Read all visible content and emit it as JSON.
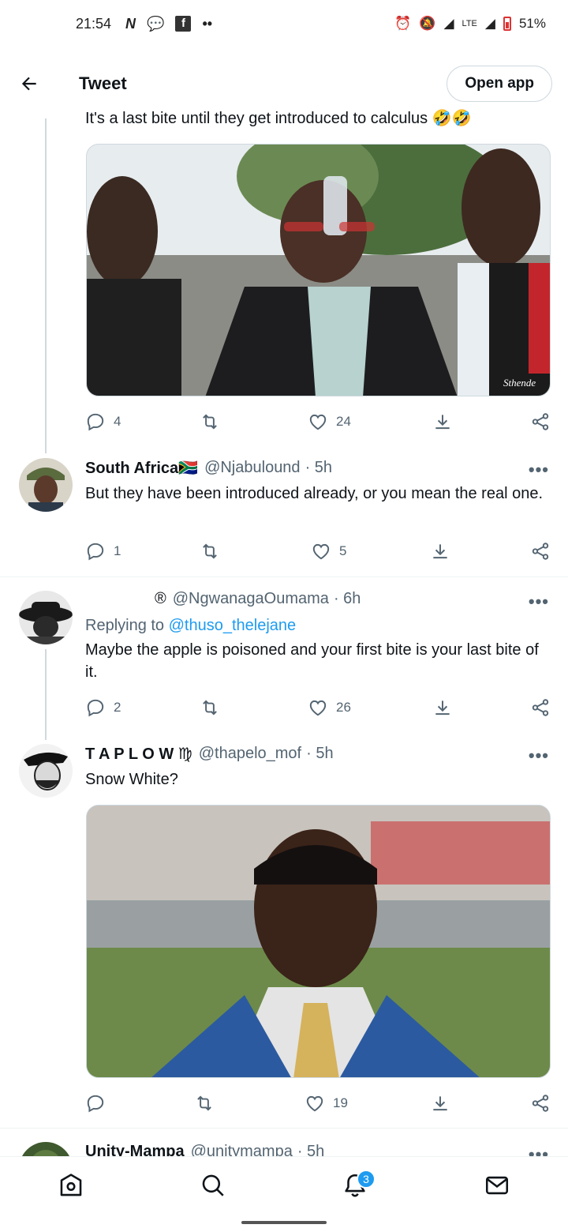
{
  "status_bar": {
    "time": "21:54",
    "battery": "51%",
    "network": "LTE"
  },
  "header": {
    "title": "Tweet",
    "open_app": "Open app"
  },
  "tweets": [
    {
      "text": "It's a last bite until they get introduced to calculus 🤣🤣",
      "media_watermark": "Sthende",
      "replies": "4",
      "retweets": "",
      "likes": "24"
    },
    {
      "name": "South Africa🇿🇦",
      "handle": "@Njabulound",
      "time": "· 5h",
      "text": "But they have been introduced already, or you mean the real one.",
      "replies": "1",
      "retweets": "",
      "likes": "5"
    },
    {
      "name": "®",
      "handle": "@NgwanagaOumama",
      "time": "· 6h",
      "replying_label": "Replying to",
      "replying_handle": "@thuso_thelejane",
      "text": "Maybe the apple is poisoned and your first bite is your last bite of it.",
      "replies": "2",
      "retweets": "",
      "likes": "26"
    },
    {
      "name": "T A P L O W ♍",
      "handle": "@thapelo_mof",
      "time": "· 5h",
      "text": "Snow White?",
      "replies": "",
      "retweets": "",
      "likes": "19"
    },
    {
      "name": "Unity-Mampa",
      "handle": "@unitymampa",
      "time": "· 5h"
    }
  ],
  "nav": {
    "notifications_badge": "3"
  },
  "colors": {
    "accent": "#1d9bf0",
    "text": "#0f1419",
    "secondary": "#536471"
  }
}
